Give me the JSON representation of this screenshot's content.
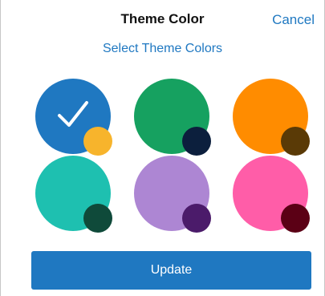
{
  "header": {
    "title": "Theme Color",
    "cancel_label": "Cancel"
  },
  "subtitle": "Select Theme Colors",
  "swatches": [
    {
      "name": "blue",
      "main": "#1f78c1",
      "accent": "#f7b42c",
      "selected": true
    },
    {
      "name": "green",
      "main": "#16a160",
      "accent": "#0c1f3d",
      "selected": false
    },
    {
      "name": "orange",
      "main": "#ff8c00",
      "accent": "#5a3a06",
      "selected": false
    },
    {
      "name": "teal",
      "main": "#1ec0b0",
      "accent": "#0f4a3a",
      "selected": false
    },
    {
      "name": "purple",
      "main": "#ad86d3",
      "accent": "#4b1b6a",
      "selected": false
    },
    {
      "name": "pink",
      "main": "#ff5da8",
      "accent": "#5b0015",
      "selected": false
    }
  ],
  "update_label": "Update"
}
